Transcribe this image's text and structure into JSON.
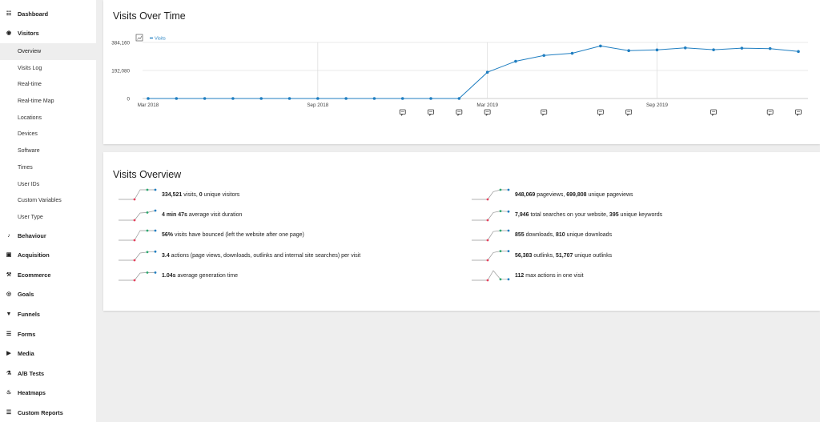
{
  "sidebar": {
    "sections": [
      {
        "label": "Dashboard",
        "icon": "dashboard-icon"
      },
      {
        "label": "Visitors",
        "icon": "visitors-icon",
        "items": [
          {
            "label": "Overview",
            "active": true
          },
          {
            "label": "Visits Log"
          },
          {
            "label": "Real-time"
          },
          {
            "label": "Real-time Map"
          },
          {
            "label": "Locations"
          },
          {
            "label": "Devices"
          },
          {
            "label": "Software"
          },
          {
            "label": "Times"
          },
          {
            "label": "User IDs"
          },
          {
            "label": "Custom Variables"
          },
          {
            "label": "User Type"
          }
        ]
      },
      {
        "label": "Behaviour",
        "icon": "bell-icon"
      },
      {
        "label": "Acquisition",
        "icon": "acquisition-icon"
      },
      {
        "label": "Ecommerce",
        "icon": "ecommerce-icon"
      },
      {
        "label": "Goals",
        "icon": "goals-icon"
      },
      {
        "label": "Funnels",
        "icon": "funnel-icon"
      },
      {
        "label": "Forms",
        "icon": "forms-icon"
      },
      {
        "label": "Media",
        "icon": "media-icon"
      },
      {
        "label": "A/B Tests",
        "icon": "flask-icon"
      },
      {
        "label": "Heatmaps",
        "icon": "heatmap-icon"
      },
      {
        "label": "Custom Reports",
        "icon": "report-icon"
      }
    ]
  },
  "visits_over_time": {
    "title": "Visits Over Time",
    "legend_label": "Visits",
    "accent": "#1f7ec1"
  },
  "chart_data": {
    "type": "line",
    "series": [
      {
        "name": "Visits",
        "values": [
          0,
          0,
          0,
          0,
          0,
          0,
          0,
          0,
          0,
          0,
          0,
          0,
          180000,
          255000,
          295000,
          310000,
          360000,
          328000,
          333000,
          347000,
          334000,
          345000,
          342000,
          322000
        ]
      }
    ],
    "x_tick_labels": [
      {
        "index": 0,
        "label": "Mar 2018"
      },
      {
        "index": 6,
        "label": "Sep 2018"
      },
      {
        "index": 12,
        "label": "Mar 2019"
      },
      {
        "index": 18,
        "label": "Sep 2019"
      }
    ],
    "y_tick_labels": [
      "384,160",
      "192,080",
      "0"
    ],
    "ylim": [
      0,
      384160
    ],
    "annotation_indices": [
      9,
      10,
      11,
      12,
      14,
      16,
      17,
      20,
      22,
      23
    ],
    "grid": true,
    "legend_position": "top-left"
  },
  "visits_overview": {
    "title": "Visits Overview",
    "left": [
      {
        "parts": [
          [
            "b",
            "334,521"
          ],
          [
            "t",
            " visits, "
          ],
          [
            "b",
            "0"
          ],
          [
            "t",
            " unique visitors"
          ]
        ],
        "spark": [
          0,
          0,
          0,
          1,
          1,
          1
        ]
      },
      {
        "parts": [
          [
            "b",
            "4 min 47s"
          ],
          [
            "t",
            " average visit duration"
          ]
        ],
        "spark": [
          0,
          0,
          0,
          0.75,
          0.8,
          1
        ]
      },
      {
        "parts": [
          [
            "b",
            "56%"
          ],
          [
            "t",
            " visits have bounced (left the website after one page)"
          ]
        ],
        "spark": [
          0,
          0,
          0,
          1,
          1,
          1
        ]
      },
      {
        "parts": [
          [
            "b",
            "3.4"
          ],
          [
            "t",
            " actions (page views, downloads, outlinks and internal site searches) per visit"
          ]
        ],
        "spark": [
          0,
          0,
          0,
          0.75,
          0.85,
          0.9
        ]
      },
      {
        "parts": [
          [
            "b",
            "1.04s"
          ],
          [
            "t",
            " average generation time"
          ]
        ],
        "spark": [
          0,
          0,
          0,
          0.75,
          0.8,
          0.8
        ]
      }
    ],
    "right": [
      {
        "parts": [
          [
            "b",
            "948,069"
          ],
          [
            "t",
            " pageviews, "
          ],
          [
            "b",
            "699,808"
          ],
          [
            "t",
            " unique pageviews"
          ]
        ],
        "spark": [
          0,
          0,
          0,
          0.8,
          1,
          1
        ]
      },
      {
        "parts": [
          [
            "b",
            "7,946"
          ],
          [
            "t",
            " total searches on your website, "
          ],
          [
            "b",
            "395"
          ],
          [
            "t",
            " unique keywords"
          ]
        ],
        "spark": [
          0,
          0,
          0,
          0.8,
          0.95,
          0.9
        ]
      },
      {
        "parts": [
          [
            "b",
            "855"
          ],
          [
            "t",
            " downloads, "
          ],
          [
            "b",
            "810"
          ],
          [
            "t",
            " unique downloads"
          ]
        ],
        "spark": [
          0,
          0,
          0,
          0.9,
          1,
          1
        ]
      },
      {
        "parts": [
          [
            "b",
            "56,383"
          ],
          [
            "t",
            " outlinks, "
          ],
          [
            "b",
            "51,707"
          ],
          [
            "t",
            " unique outlinks"
          ]
        ],
        "spark": [
          0,
          0,
          0,
          0.8,
          0.95,
          0.95
        ]
      },
      {
        "parts": [
          [
            "b",
            "112"
          ],
          [
            "t",
            " max actions in one visit"
          ]
        ],
        "spark": [
          0,
          0,
          0,
          1,
          0.1,
          0.1
        ]
      }
    ]
  }
}
